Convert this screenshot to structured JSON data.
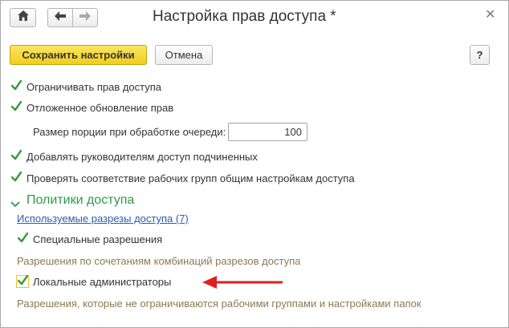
{
  "window": {
    "title": "Настройка прав доступа *",
    "close_icon": "close-icon"
  },
  "toolbar": {
    "home_icon": "home-icon",
    "back_icon": "arrow-left-icon",
    "forward_icon": "arrow-right-icon"
  },
  "actions": {
    "save_label": "Сохранить настройки",
    "cancel_label": "Отмена",
    "help_label": "?"
  },
  "settings": {
    "restrict_access": {
      "label": "Ограничивать прав доступа",
      "checked": true
    },
    "deferred_update": {
      "label": "Отложенное обновление прав",
      "checked": true
    },
    "batch_size": {
      "label": "Размер порции при обработке очереди:",
      "value": "100"
    },
    "managers_access": {
      "label": "Добавлять руководителям доступ подчиненных",
      "checked": true
    },
    "check_workgroups": {
      "label": "Проверять соответствие рабочих групп общим настройкам доступа",
      "checked": true
    }
  },
  "policies": {
    "title": "Политики доступа",
    "sections_link": "Используемые разрезы доступа (7)",
    "special_permissions": {
      "label": "Специальные разрешения",
      "checked": true,
      "description": "Разрешения по сочетаниям комбинаций разрезов доступа"
    },
    "local_admins": {
      "label": "Локальные администраторы",
      "checked": true,
      "description": "Разрешения, которые не ограничиваются рабочими группами и настройками папок"
    }
  },
  "colors": {
    "accent_green": "#2e9a48",
    "check_green": "#3a9a3a",
    "primary_yellow": "#f1cd1b",
    "arrow_red": "#e02020",
    "note_text": "#8a7a52"
  }
}
